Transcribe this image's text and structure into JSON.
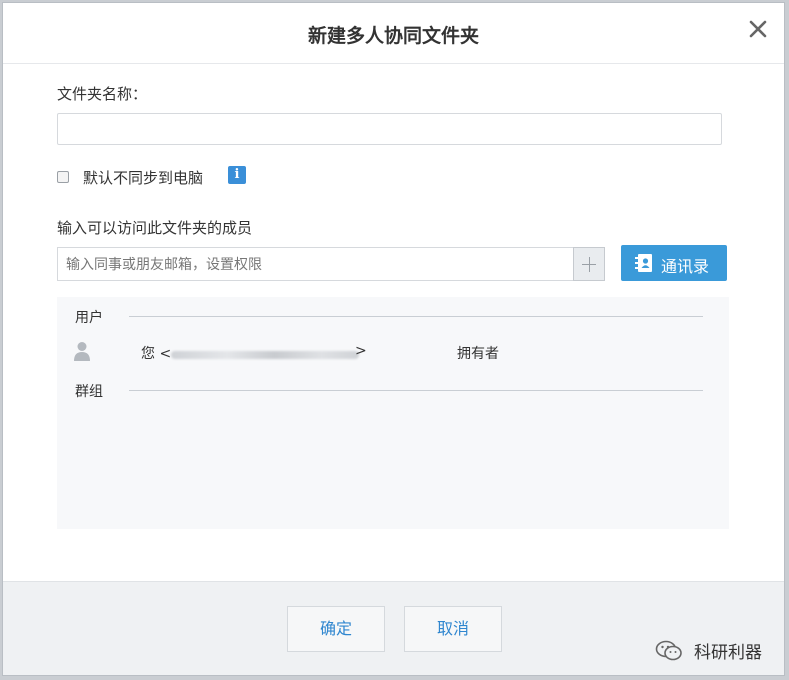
{
  "dialog": {
    "title": "新建多人协同文件夹",
    "close_icon": "close-icon"
  },
  "form": {
    "folder_name_label": "文件夹名称：",
    "folder_name_value": "",
    "sync_checkbox_label": "默认不同步到电脑",
    "sync_checked": false,
    "info_icon": "i",
    "members_label": "输入可以访问此文件夹的成员",
    "member_input_placeholder": "输入同事或朋友邮箱，设置权限",
    "contacts_button": "通讯录"
  },
  "members": {
    "users_heading": "用户",
    "groups_heading": "群组",
    "users": [
      {
        "name_prefix": "您 <",
        "name_suffix": ">",
        "role": "拥有者"
      }
    ]
  },
  "footer": {
    "confirm_label": "确定",
    "cancel_label": "取消"
  },
  "watermark": {
    "text": "科研利器"
  },
  "colors": {
    "accent": "#3a9ad9",
    "link_text": "#2f86cf",
    "info_icon": "#3a8fd8"
  }
}
